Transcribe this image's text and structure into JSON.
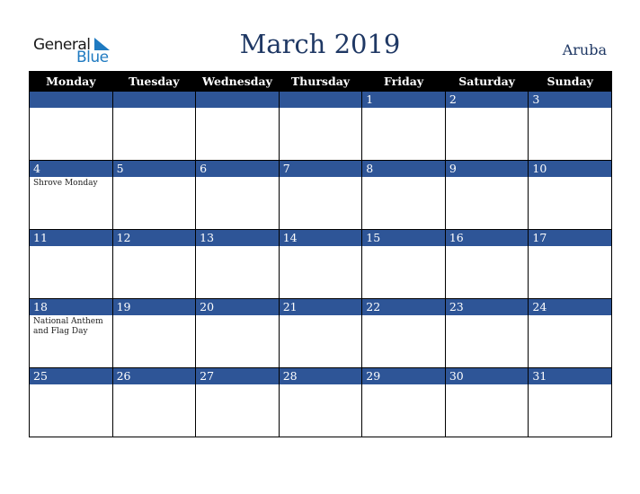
{
  "logo": {
    "line1": "General",
    "line2": "Blue"
  },
  "title": "March 2019",
  "country": "Aruba",
  "weekdays": [
    "Monday",
    "Tuesday",
    "Wednesday",
    "Thursday",
    "Friday",
    "Saturday",
    "Sunday"
  ],
  "weeks": [
    [
      {
        "day": "",
        "event": ""
      },
      {
        "day": "",
        "event": ""
      },
      {
        "day": "",
        "event": ""
      },
      {
        "day": "",
        "event": ""
      },
      {
        "day": "1",
        "event": ""
      },
      {
        "day": "2",
        "event": ""
      },
      {
        "day": "3",
        "event": ""
      }
    ],
    [
      {
        "day": "4",
        "event": "Shrove Monday"
      },
      {
        "day": "5",
        "event": ""
      },
      {
        "day": "6",
        "event": ""
      },
      {
        "day": "7",
        "event": ""
      },
      {
        "day": "8",
        "event": ""
      },
      {
        "day": "9",
        "event": ""
      },
      {
        "day": "10",
        "event": ""
      }
    ],
    [
      {
        "day": "11",
        "event": ""
      },
      {
        "day": "12",
        "event": ""
      },
      {
        "day": "13",
        "event": ""
      },
      {
        "day": "14",
        "event": ""
      },
      {
        "day": "15",
        "event": ""
      },
      {
        "day": "16",
        "event": ""
      },
      {
        "day": "17",
        "event": ""
      }
    ],
    [
      {
        "day": "18",
        "event": "National Anthem and Flag Day"
      },
      {
        "day": "19",
        "event": ""
      },
      {
        "day": "20",
        "event": ""
      },
      {
        "day": "21",
        "event": ""
      },
      {
        "day": "22",
        "event": ""
      },
      {
        "day": "23",
        "event": ""
      },
      {
        "day": "24",
        "event": ""
      }
    ],
    [
      {
        "day": "25",
        "event": ""
      },
      {
        "day": "26",
        "event": ""
      },
      {
        "day": "27",
        "event": ""
      },
      {
        "day": "28",
        "event": ""
      },
      {
        "day": "29",
        "event": ""
      },
      {
        "day": "30",
        "event": ""
      },
      {
        "day": "31",
        "event": ""
      }
    ]
  ]
}
